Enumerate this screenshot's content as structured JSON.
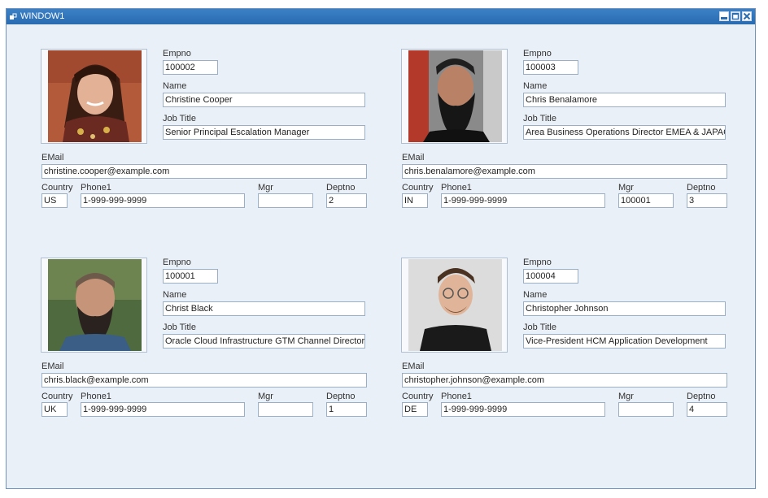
{
  "window": {
    "title": "WINDOW1"
  },
  "labels": {
    "empno": "Empno",
    "name": "Name",
    "job_title": "Job Title",
    "email": "EMail",
    "country": "Country",
    "phone1": "Phone1",
    "mgr": "Mgr",
    "deptno": "Deptno"
  },
  "colors": {
    "titlebar": "#2a6bb0",
    "background": "#eaf0f7",
    "field_border": "#9aaec6"
  },
  "employees": [
    {
      "empno": "100002",
      "name": "Christine Cooper",
      "job_title": "Senior Principal Escalation Manager",
      "email": "christine.cooper@example.com",
      "country": "US",
      "phone1": "1-999-999-9999",
      "mgr": "",
      "deptno": "2"
    },
    {
      "empno": "100003",
      "name": "Chris Benalamore",
      "job_title": "Area Business Operations Director EMEA & JAPAC",
      "email": "chris.benalamore@example.com",
      "country": "IN",
      "phone1": "1-999-999-9999",
      "mgr": "100001",
      "deptno": "3"
    },
    {
      "empno": "100001",
      "name": "Christ Black",
      "job_title": "Oracle Cloud Infrastructure GTM Channel Director",
      "email": "chris.black@example.com",
      "country": "UK",
      "phone1": "1-999-999-9999",
      "mgr": "",
      "deptno": "1"
    },
    {
      "empno": "100004",
      "name": "Christopher Johnson",
      "job_title": "Vice-President HCM Application Development",
      "email": "christopher.johnson@example.com",
      "country": "DE",
      "phone1": "1-999-999-9999",
      "mgr": "",
      "deptno": "4"
    }
  ]
}
